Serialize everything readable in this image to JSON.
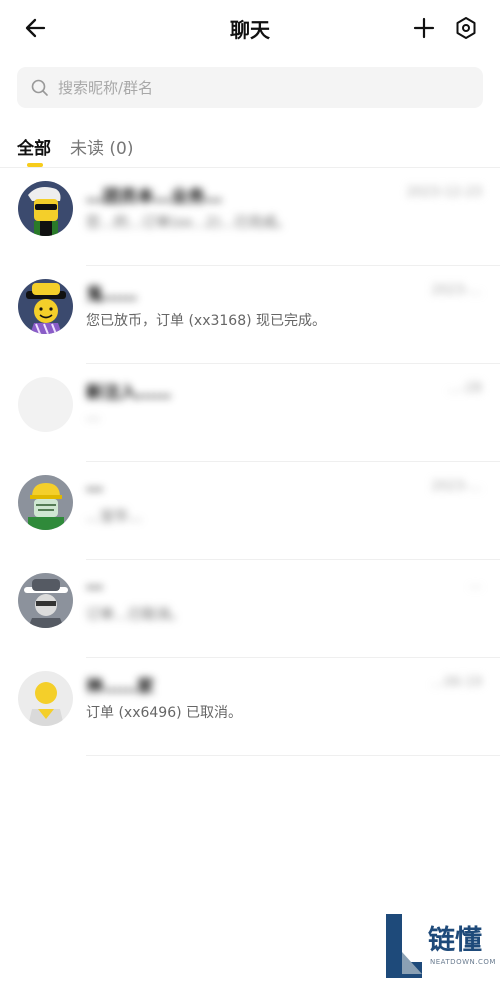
{
  "header": {
    "title": "聊天"
  },
  "search": {
    "placeholder": "搜索昵称/群名"
  },
  "tabs": [
    {
      "label": "全部",
      "active": true
    },
    {
      "label": "未读 (0)",
      "active": false
    }
  ],
  "accent_color": "#f7cc1c",
  "chats": [
    {
      "name": "…团员本…业务…",
      "date": "2023-12-23",
      "message": "您…的…订单(xx…2)…已完成。",
      "avatar": "sunglasses-character-avatar",
      "redacted": true
    },
    {
      "name": "鬼……",
      "date": "2023-…",
      "message": "您已放币，订单 (xx3168) 现已完成。",
      "avatar": "yellow-hat-character-avatar",
      "redacted_name": true
    },
    {
      "name": "新注入……",
      "date": "…-28",
      "message": "…",
      "avatar": "blank-avatar",
      "redacted": true
    },
    {
      "name": "…",
      "date": "2023-…",
      "message": "…宝华…",
      "avatar": "helmet-character-avatar",
      "redacted": true
    },
    {
      "name": "…",
      "date": "…",
      "message": "订单…已取消。",
      "avatar": "grey-hat-character-avatar",
      "redacted": true
    },
    {
      "name": "神……家",
      "date": "…06-19",
      "message": "订单 (xx6496) 已取消。",
      "avatar": "default-yellow-avatar",
      "redacted_name": true
    }
  ],
  "watermark": {
    "main": "链懂",
    "sub": "NEATDOWN.COM"
  }
}
